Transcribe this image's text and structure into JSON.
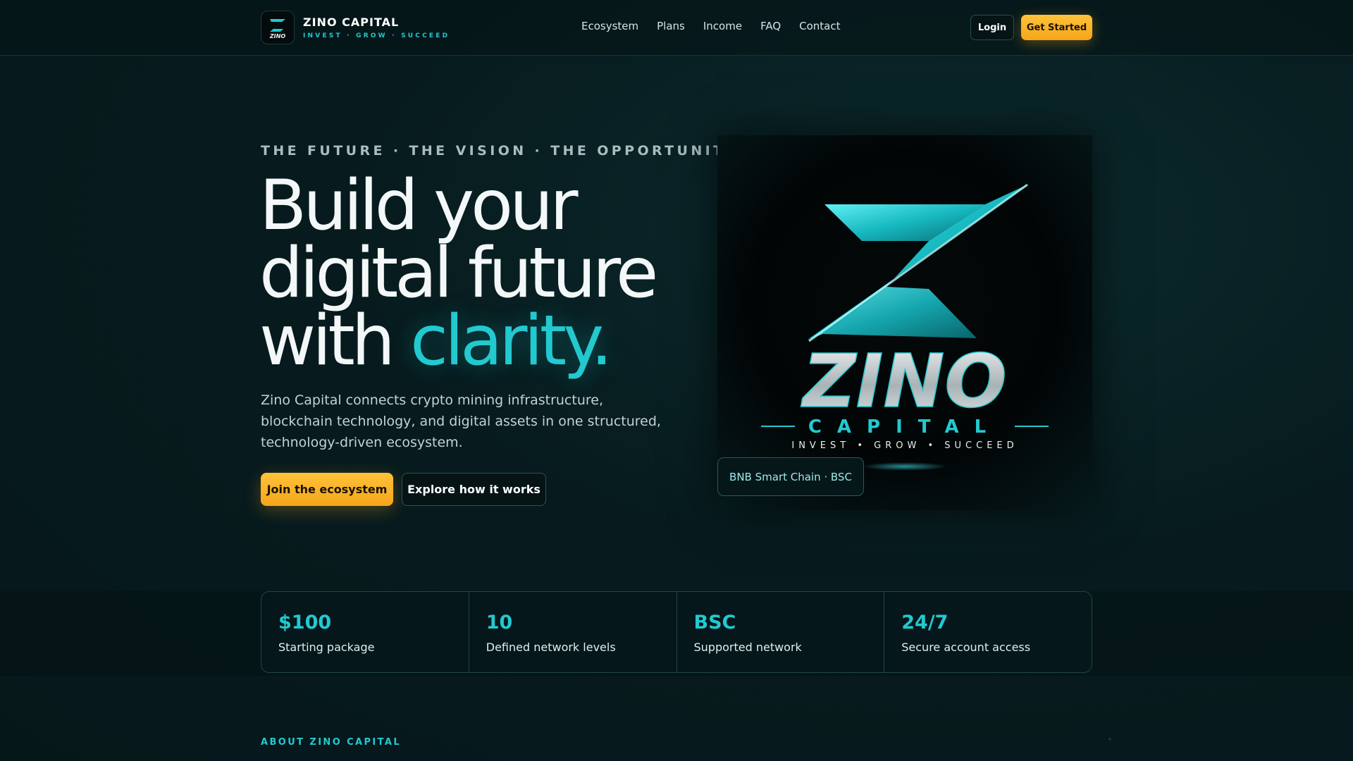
{
  "brand": {
    "name": "ZINO CAPITAL",
    "tagline": "INVEST · GROW · SUCCEED",
    "logo_letter": "Z",
    "logo_word": "ZINO"
  },
  "nav": {
    "links": [
      "Ecosystem",
      "Plans",
      "Income",
      "FAQ",
      "Contact"
    ],
    "login_label": "Login",
    "get_started_label": "Get Started"
  },
  "hero": {
    "eyebrow": "THE FUTURE · THE VISION · THE OPPORTUNITY",
    "title_line1": "Build your",
    "title_line2": "digital future",
    "title_line3_plain": "with ",
    "title_line3_accent": "clarity.",
    "description": "Zino Capital connects crypto mining infrastructure, blockchain technology, and digital assets in one structured, technology-driven ecosystem.",
    "primary_cta": "Join the ecosystem",
    "secondary_cta": "Explore how it works",
    "art": {
      "word": "ZINO",
      "sub": "CAPITAL",
      "tagline": "INVEST • GROW • SUCCEED"
    },
    "chain_badge": "BNB Smart Chain · BSC"
  },
  "stats": [
    {
      "value": "$100",
      "label": "Starting package"
    },
    {
      "value": "10",
      "label": "Defined network levels"
    },
    {
      "value": "BSC",
      "label": "Supported network"
    },
    {
      "value": "24/7",
      "label": "Secure account access"
    }
  ],
  "about": {
    "eyebrow": "ABOUT ZINO CAPITAL"
  },
  "colors": {
    "accent": "#22c9cf",
    "cta": "#f6a51a",
    "background": "#071b1e"
  }
}
